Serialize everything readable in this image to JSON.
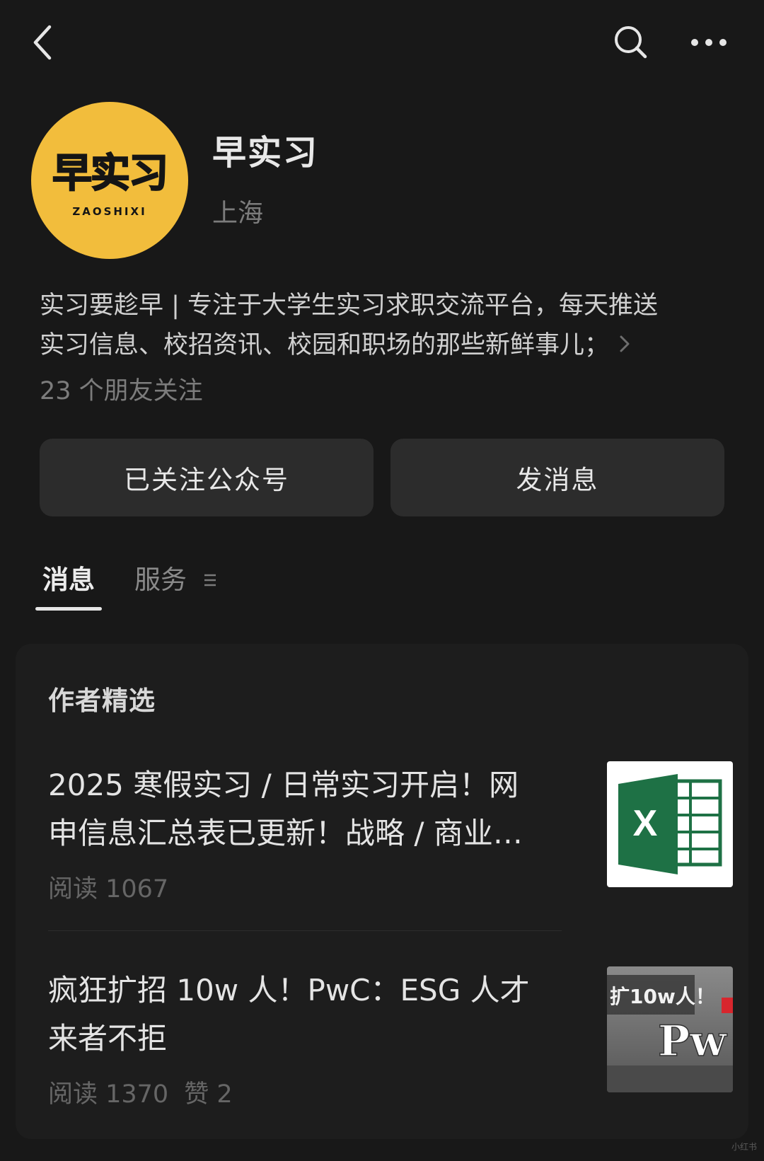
{
  "header": {
    "back_icon": "chevron-left-icon",
    "search_icon": "search-icon",
    "more_icon": "more-horizontal-icon"
  },
  "profile": {
    "avatar_text": "早实习",
    "avatar_subtext": "ZAOSHIXI",
    "avatar_color": "#f2bd3c",
    "name": "早实习",
    "location": "上海",
    "bio_line1": "实习要趁早 | 专注于大学生实习求职交流平台，每天推送",
    "bio_line2": "实习信息、校招资讯、校园和职场的那些新鲜事儿；",
    "followers": "23 个朋友关注"
  },
  "actions": {
    "follow_label": "已关注公众号",
    "message_label": "发消息"
  },
  "tabs": {
    "messages": "消息",
    "services": "服务",
    "active": "消息"
  },
  "selection": {
    "title": "作者精选",
    "articles": [
      {
        "title_line1": "2025 寒假实习 / 日常实习开启！网",
        "title_line2": "申信息汇总表已更新！战略 / 商业…",
        "reads": "阅读 1067",
        "thumb_icon": "excel-icon"
      },
      {
        "title_line1": "疯狂扩招 10w 人！PwC：ESG 人才",
        "title_line2": "来者不拒",
        "reads": "阅读 1370",
        "likes": "赞 2",
        "thumb_text_1": "扩10w人！",
        "thumb_text_2": "Pw"
      }
    ]
  },
  "watermark": "小红书"
}
